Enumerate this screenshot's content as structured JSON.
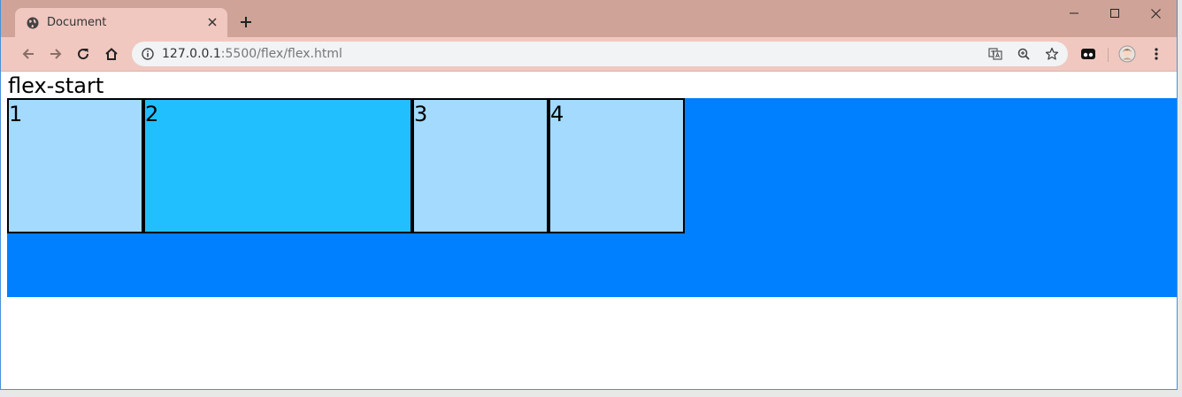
{
  "browser": {
    "tab": {
      "title": "Document"
    },
    "address": {
      "host": "127.0.0.1",
      "path": ":5500/flex/flex.html"
    }
  },
  "page": {
    "heading": "flex-start",
    "container_color": "#0080ff",
    "items": [
      {
        "label": "1",
        "color": "#a3dafd"
      },
      {
        "label": "2",
        "color": "#22bfff"
      },
      {
        "label": "3",
        "color": "#a3dafd"
      },
      {
        "label": "4",
        "color": "#a3dafd"
      }
    ]
  }
}
